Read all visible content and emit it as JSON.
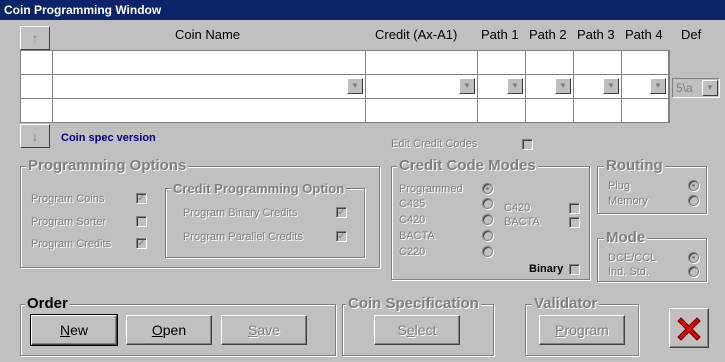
{
  "window": {
    "title": "Coin Programming Window"
  },
  "table": {
    "headers": {
      "coin_name": "Coin Name",
      "credit": "Credit (Ax-A1)",
      "path1": "Path 1",
      "path2": "Path 2",
      "path3": "Path 3",
      "path4": "Path 4",
      "def": "Def"
    },
    "def_value": "5\\a",
    "coin_spec_version": "Coin spec version"
  },
  "edit_credit_codes": {
    "label": "Edit Credit Codes"
  },
  "programming_options": {
    "title": "Programming Options",
    "program_coins": "Program Coins",
    "program_sorter": "Program Sorter",
    "program_credits": "Program Credits"
  },
  "credit_programming_option": {
    "title": "Credit Programming Option",
    "binary": "Program Binary Credits",
    "parallel": "Program Parallel Credits"
  },
  "credit_code_modes": {
    "title": "Credit Code Modes",
    "programmed": "Programmed",
    "c435": "C435",
    "c420": "C420",
    "bacta": "BACTA",
    "c220": "C220",
    "c420_chk": "C420",
    "bacta_chk": "BACTA",
    "binary": "Binary"
  },
  "routing": {
    "title": "Routing",
    "plug": "Plug",
    "memory": "Memory"
  },
  "mode": {
    "title": "Mode",
    "dce": "DCE/CCL",
    "ind": "Ind. Std."
  },
  "order": {
    "title": "Order",
    "new": "New",
    "new_ul": "N",
    "new_rest": "ew",
    "open": "Open",
    "open_ul": "O",
    "open_rest": "pen",
    "save": "Save",
    "save_ul": "S",
    "save_rest": "ave"
  },
  "coin_specification": {
    "title": "Coin Specification",
    "select": "Select",
    "select_ul": "e",
    "select_pre": "S",
    "select_post": "lect"
  },
  "validator": {
    "title": "Validator",
    "program": "Program",
    "program_ul": "P",
    "program_rest": "rogram"
  },
  "close_icon": "close-x-icon"
}
